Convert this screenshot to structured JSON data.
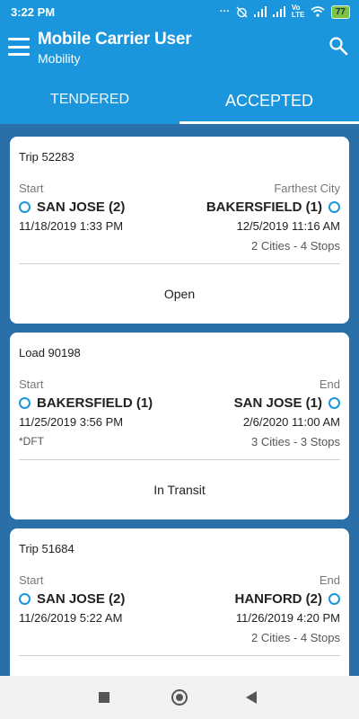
{
  "status_bar": {
    "time": "3:22 PM",
    "volte": "Vo LTE",
    "battery": "77"
  },
  "header": {
    "title": "Mobile Carrier User",
    "subtitle": "Mobility",
    "menu_icon": "hamburger-menu-icon",
    "search_icon": "search-icon"
  },
  "tabs": [
    {
      "label": "TENDERED",
      "active": false
    },
    {
      "label": "ACCEPTED",
      "active": true
    }
  ],
  "cards": [
    {
      "title": "Trip 52283",
      "left_label": "Start",
      "right_label": "Farthest City",
      "left_city": "SAN JOSE (2)",
      "right_city": "BAKERSFIELD (1)",
      "left_date": "11/18/2019 1:33 PM",
      "right_date": "12/5/2019 11:16 AM",
      "note": "",
      "summary": "2 Cities - 4 Stops",
      "status": "Open"
    },
    {
      "title": "Load 90198",
      "left_label": "Start",
      "right_label": "End",
      "left_city": "BAKERSFIELD (1)",
      "right_city": "SAN JOSE (1)",
      "left_date": "11/25/2019 3:56 PM",
      "right_date": "2/6/2020 11:00 AM",
      "note": "*DFT",
      "summary": "3 Cities - 3 Stops",
      "status": "In Transit"
    },
    {
      "title": "Trip 51684",
      "left_label": "Start",
      "right_label": "End",
      "left_city": "SAN JOSE (2)",
      "right_city": "HANFORD (2)",
      "left_date": "11/26/2019 5:22 AM",
      "right_date": "11/26/2019 4:20 PM",
      "note": "",
      "summary": "2 Cities - 4 Stops",
      "status": ""
    }
  ],
  "colors": {
    "app_bar": "#1b96dc",
    "background": "#2a6fa8",
    "ring": "#1b96dc"
  }
}
